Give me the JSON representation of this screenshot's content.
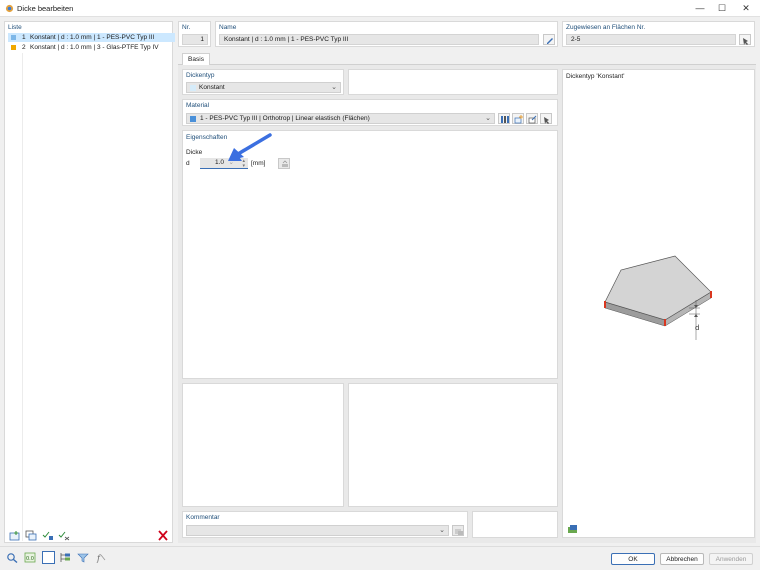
{
  "window": {
    "title": "Dicke bearbeiten",
    "minimize": "—",
    "maximize": "☐",
    "close": "✕"
  },
  "list": {
    "header": "Liste",
    "items": [
      {
        "no": "1",
        "text": "Konstant | d : 1.0 mm | 1 - PES-PVC Typ III",
        "color": "#7db7e8",
        "selected": true
      },
      {
        "no": "2",
        "text": "Konstant | d : 1.0 mm | 3 - Glas-PTFE Typ IV",
        "color": "#f0a800",
        "selected": false
      }
    ]
  },
  "header": {
    "nr_label": "Nr.",
    "nr_value": "1",
    "name_label": "Name",
    "name_value": "Konstant | d : 1.0 mm | 1 - PES-PVC Typ III",
    "assigned_label": "Zugewiesen an Flächen Nr.",
    "assigned_value": "2-5"
  },
  "tabs": [
    {
      "label": "Basis"
    }
  ],
  "thickness_type": {
    "label": "Dickentyp",
    "value": "Konstant"
  },
  "material": {
    "label": "Material",
    "value": "1 - PES-PVC Typ III | Orthotrop | Linear elastisch (Flächen)",
    "color": "#4a90d9"
  },
  "properties": {
    "label": "Eigenschaften",
    "sub_label": "Dicke",
    "symbol": "d",
    "value": "1.0",
    "unit": "[mm]"
  },
  "preview": {
    "title": "Dickentyp  'Konstant'",
    "dimension_label": "d"
  },
  "comment": {
    "label": "Kommentar",
    "value": ""
  },
  "buttons": {
    "ok": "OK",
    "cancel": "Abbrechen",
    "apply": "Anwenden"
  },
  "colors": {
    "accent_selected": "#cce8ff",
    "arrow": "#3b6fe0",
    "plate_top": "#d4d4d4",
    "plate_edge": "#9a9a9a",
    "support_red": "#d9361f"
  }
}
